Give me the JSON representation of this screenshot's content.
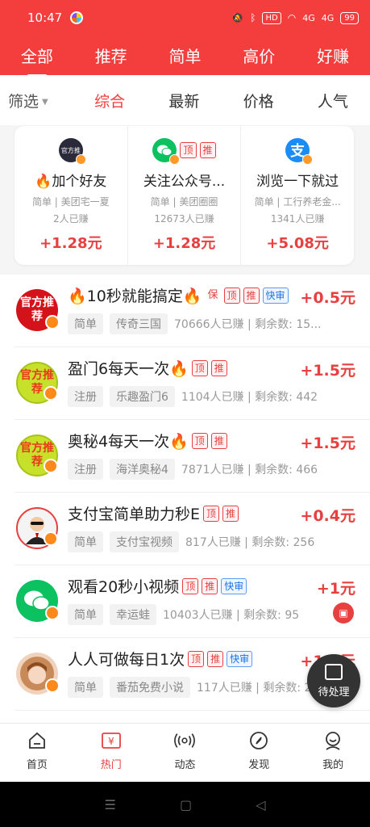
{
  "status_bar": {
    "time": "10:47",
    "hd": "HD",
    "net1": "4G",
    "net2": "4G",
    "battery": "99"
  },
  "top_tabs": [
    "全部",
    "推荐",
    "简单",
    "高价",
    "好赚"
  ],
  "filter": {
    "label": "筛选",
    "sorts": [
      "综合",
      "最新",
      "价格",
      "人气"
    ]
  },
  "featured": [
    {
      "icon": "官方推",
      "title": "🔥加个好友",
      "sub": "简单 | 美团宅一夏",
      "count": "2人已赚",
      "price": "+1.28元"
    },
    {
      "title": "关注公众号...",
      "sub": "简单 | 美团圈圈",
      "count": "12673人已赚",
      "price": "+1.28元",
      "tag_top": "顶",
      "tag_rec": "推"
    },
    {
      "icon": "支",
      "title": "浏览一下就过",
      "sub": "简单 | 工行养老金...",
      "count": "1341人已赚",
      "price": "+5.08元"
    }
  ],
  "tags": {
    "top": "顶",
    "rec": "推",
    "fast": "快审",
    "bao": "保"
  },
  "tasks": [
    {
      "avatar": "官方推荐",
      "title": "🔥10秒就能搞定🔥",
      "type": "简单",
      "app": "传奇三国",
      "stats": "70666人已赚 | 剩余数: 15...",
      "price": "+0.5元"
    },
    {
      "avatar": "官方推荐",
      "title": "盈门6每天一次🔥",
      "type": "注册",
      "app": "乐趣盈门6",
      "stats": "1104人已赚 | 剩余数: 442",
      "price": "+1.5元"
    },
    {
      "avatar": "官方推荐",
      "title": "奥秘4每天一次🔥",
      "type": "注册",
      "app": "海洋奥秘4",
      "stats": "7871人已赚 | 剩余数: 466",
      "price": "+1.5元"
    },
    {
      "title": "支付宝简单助力秒E",
      "type": "简单",
      "app": "支付宝视频",
      "stats": "817人已赚 | 剩余数: 256",
      "price": "+0.4元"
    },
    {
      "title": "观看20秒小视频",
      "type": "简单",
      "app": "幸运蛙",
      "stats": "10403人已赚 | 剩余数: 95",
      "price": "+1元"
    },
    {
      "title": "人人可做每日1次",
      "type": "简单",
      "app": "番茄免费小说",
      "stats": "117人已赚 | 剩余数: 2...",
      "price": "+1.5元"
    }
  ],
  "pending": "待处理",
  "bottom_nav": [
    "首页",
    "热门",
    "动态",
    "发现",
    "我的"
  ],
  "colors": {
    "primary_red": "#f43d3d",
    "price_red": "#e84040",
    "fast_blue": "#1a73e8"
  },
  "icons": {
    "home": "home-icon",
    "hot": "yuan-ticket-icon",
    "feed": "broadcast-icon",
    "discover": "compass-icon",
    "mine": "smile-icon"
  }
}
